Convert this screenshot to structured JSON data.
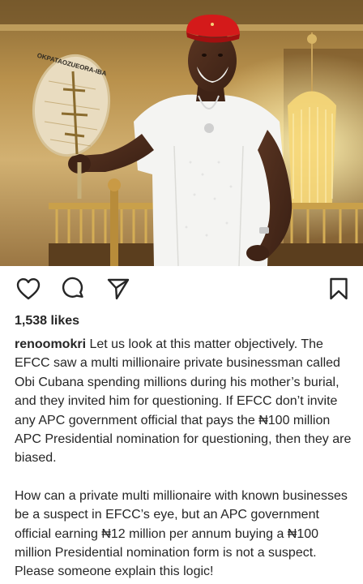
{
  "post": {
    "image_alt": "Obi Cubana in white outfit and red cap holding a hand fan",
    "fan_text": "OKPATAOZUEORA-IBA",
    "likes": "1,538 likes",
    "username": "renoomokri",
    "caption_p1": " Let us look at this matter objectively. The EFCC saw a multi millionaire private businessman called Obi Cubana spending millions during his mother’s burial, and they invited him for questioning. If EFCC don’t invite any APC government official that pays the ₦100 million APC Presidential nomination for questioning, then they are biased.",
    "caption_p2": "How can a private multi millionaire with known businesses be a suspect in EFCC’s eye, but an APC government official earning ₦12 million per annum buying a ₦100 million Presidential nomination form is not a suspect. Please someone explain this logic!"
  },
  "actions": {
    "like_icon": "heart-icon",
    "comment_icon": "comment-icon",
    "share_icon": "paper-plane-icon",
    "save_icon": "bookmark-icon"
  },
  "colors": {
    "text": "#262626",
    "cap_red": "#d41a1a",
    "outfit_white": "#f4f4f2"
  }
}
